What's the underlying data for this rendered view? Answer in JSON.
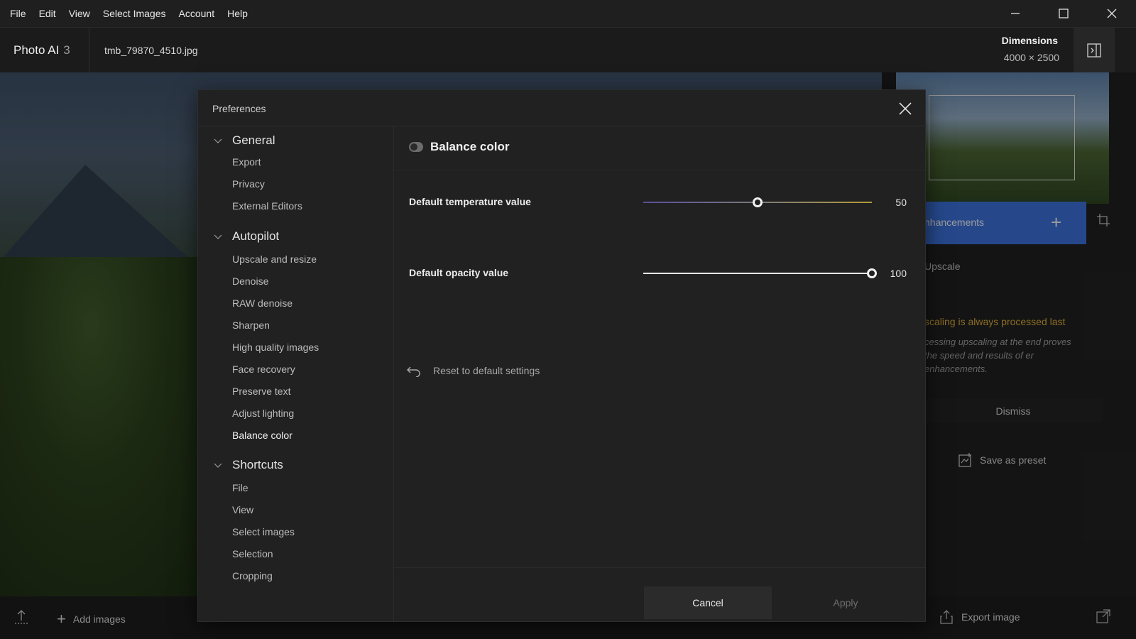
{
  "menubar": {
    "items": [
      "File",
      "Edit",
      "View",
      "Select Images",
      "Account",
      "Help"
    ],
    "window_controls": [
      "minimize-icon",
      "maximize-icon",
      "close-icon"
    ]
  },
  "header": {
    "app_name": "Photo AI",
    "app_version": "3",
    "filename": "tmb_79870_4510.jpg",
    "dimensions_label": "Dimensions",
    "dimensions_value": "4000 × 2500"
  },
  "right_panel": {
    "enhancements_label": "nhancements",
    "upscale_label": "Upscale",
    "warning_title": "scaling is always processed last",
    "warning_body": "cessing upscaling at the end proves the speed and results of er enhancements.",
    "dismiss_label": "Dismiss",
    "save_preset_label": "Save as preset"
  },
  "bottombar": {
    "add_images_label": "Add images",
    "export_label": "Export image"
  },
  "dialog": {
    "title": "Preferences",
    "nav": {
      "general": {
        "label": "General",
        "items": [
          "Export",
          "Privacy",
          "External Editors"
        ]
      },
      "autopilot": {
        "label": "Autopilot",
        "items": [
          "Upscale and resize",
          "Denoise",
          "RAW denoise",
          "Sharpen",
          "High quality images",
          "Face recovery",
          "Preserve text",
          "Adjust lighting",
          "Balance color"
        ]
      },
      "shortcuts": {
        "label": "Shortcuts",
        "items": [
          "File",
          "View",
          "Select images",
          "Selection",
          "Cropping"
        ]
      },
      "active_item": "Balance color"
    },
    "content": {
      "title": "Balance color",
      "temperature": {
        "label": "Default temperature value",
        "value": "50",
        "min": 0,
        "max": 100
      },
      "opacity": {
        "label": "Default opacity value",
        "value": "100",
        "min": 0,
        "max": 100
      },
      "reset_label": "Reset to default settings"
    },
    "buttons": {
      "cancel": "Cancel",
      "apply": "Apply"
    }
  },
  "colors": {
    "accent": "#3b6fd6",
    "warning": "#d6a83a",
    "temp_track_start": "#5a4f9c",
    "temp_track_end": "#b39b3a"
  }
}
